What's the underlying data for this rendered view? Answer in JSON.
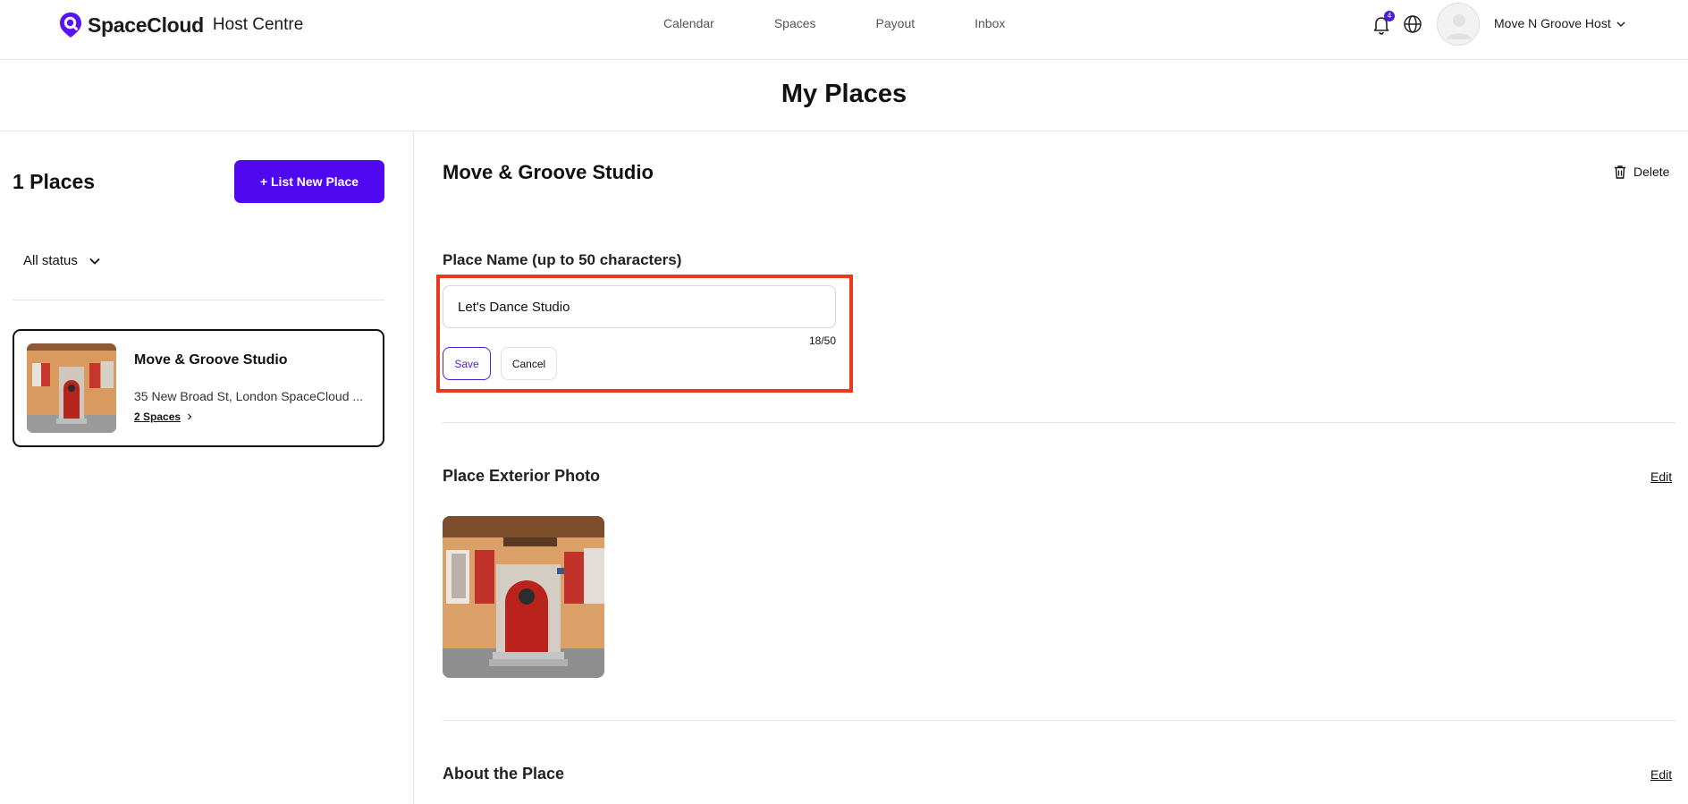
{
  "brand": {
    "name": "SpaceCloud",
    "sub": "Host Centre",
    "accent": "#4f08f0"
  },
  "nav": {
    "items": [
      {
        "label": "Calendar"
      },
      {
        "label": "Spaces"
      },
      {
        "label": "Payout"
      },
      {
        "label": "Inbox"
      }
    ]
  },
  "header": {
    "notification_count": "4",
    "user_name": "Move N Groove Host"
  },
  "page": {
    "title": "My Places"
  },
  "sidebar": {
    "count_label": "1 Places",
    "list_new_label": "+ List New Place",
    "status_filter": "All status",
    "places": [
      {
        "name": "Move & Groove Studio",
        "address": "35 New Broad St, London SpaceCloud ...",
        "spaces_link": "2 Spaces"
      }
    ]
  },
  "main": {
    "place_title": "Move & Groove Studio",
    "delete_label": "Delete",
    "name_field": {
      "label": "Place Name (up to 50 characters)",
      "value": "Let's Dance Studio",
      "char_count": "18/50",
      "save_label": "Save",
      "cancel_label": "Cancel"
    },
    "exterior": {
      "title": "Place Exterior Photo",
      "edit_label": "Edit"
    },
    "about": {
      "title": "About the Place",
      "edit_label": "Edit"
    }
  },
  "colors": {
    "highlight": "#e8391f",
    "primary": "#4f08f0"
  }
}
